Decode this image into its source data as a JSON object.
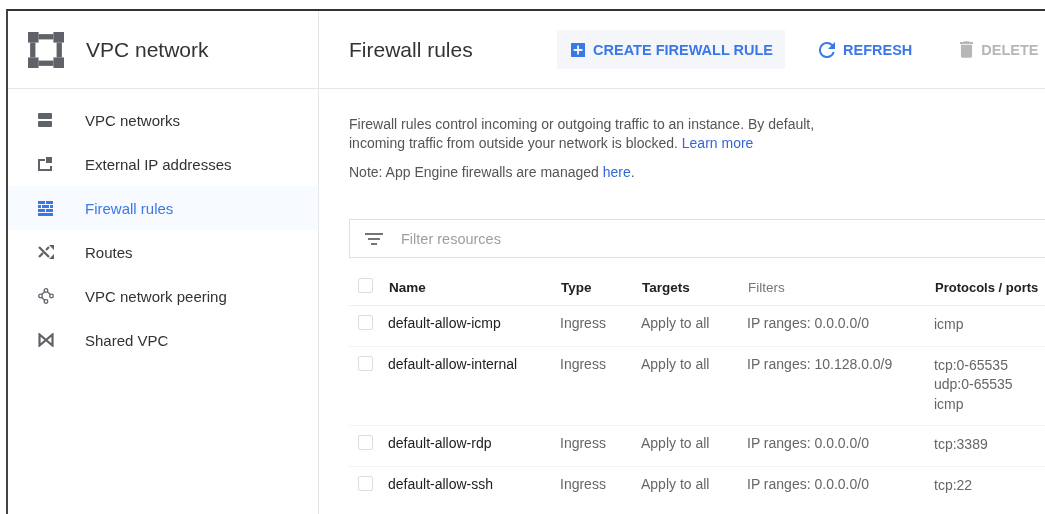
{
  "sidebar": {
    "title": "VPC network",
    "items": [
      {
        "label": "VPC networks",
        "selected": false
      },
      {
        "label": "External IP addresses",
        "selected": false
      },
      {
        "label": "Firewall rules",
        "selected": true
      },
      {
        "label": "Routes",
        "selected": false
      },
      {
        "label": "VPC network peering",
        "selected": false
      },
      {
        "label": "Shared VPC",
        "selected": false
      }
    ]
  },
  "header": {
    "title": "Firewall rules",
    "actions": [
      {
        "label": "CREATE FIREWALL RULE",
        "disabled": false
      },
      {
        "label": "REFRESH",
        "disabled": false
      },
      {
        "label": "DELETE",
        "disabled": true
      }
    ]
  },
  "description": {
    "text": "Firewall rules control incoming or outgoing traffic to an instance. By default, incoming traffic from outside your network is blocked.",
    "link": "Learn more"
  },
  "note": {
    "text": "Note: App Engine firewalls are managed",
    "link": "here",
    "suffix": "."
  },
  "filter": {
    "placeholder": "Filter resources"
  },
  "table": {
    "select_all_checked": false,
    "columns": [
      {
        "label": "Name",
        "sortable": true
      },
      {
        "label": "Type",
        "sortable": true
      },
      {
        "label": "Targets",
        "sortable": true
      },
      {
        "label": "Filters",
        "sortable": false
      },
      {
        "label": "Protocols / ports",
        "sortable": true
      }
    ],
    "rows": [
      {
        "checked": false,
        "name": "default-allow-icmp",
        "type": "Ingress",
        "targets": "Apply to all",
        "filters": "IP ranges: 0.0.0.0/0",
        "protocols": [
          "icmp"
        ]
      },
      {
        "checked": false,
        "name": "default-allow-internal",
        "type": "Ingress",
        "targets": "Apply to all",
        "filters": "IP ranges: 10.128.0.0/9",
        "protocols": [
          "tcp:0-65535",
          "udp:0-65535",
          "icmp"
        ]
      },
      {
        "checked": false,
        "name": "default-allow-rdp",
        "type": "Ingress",
        "targets": "Apply to all",
        "filters": "IP ranges: 0.0.0.0/0",
        "protocols": [
          "tcp:3389"
        ]
      },
      {
        "checked": false,
        "name": "default-allow-ssh",
        "type": "Ingress",
        "targets": "Apply to all",
        "filters": "IP ranges: 0.0.0.0/0",
        "protocols": [
          "tcp:22"
        ]
      }
    ]
  }
}
